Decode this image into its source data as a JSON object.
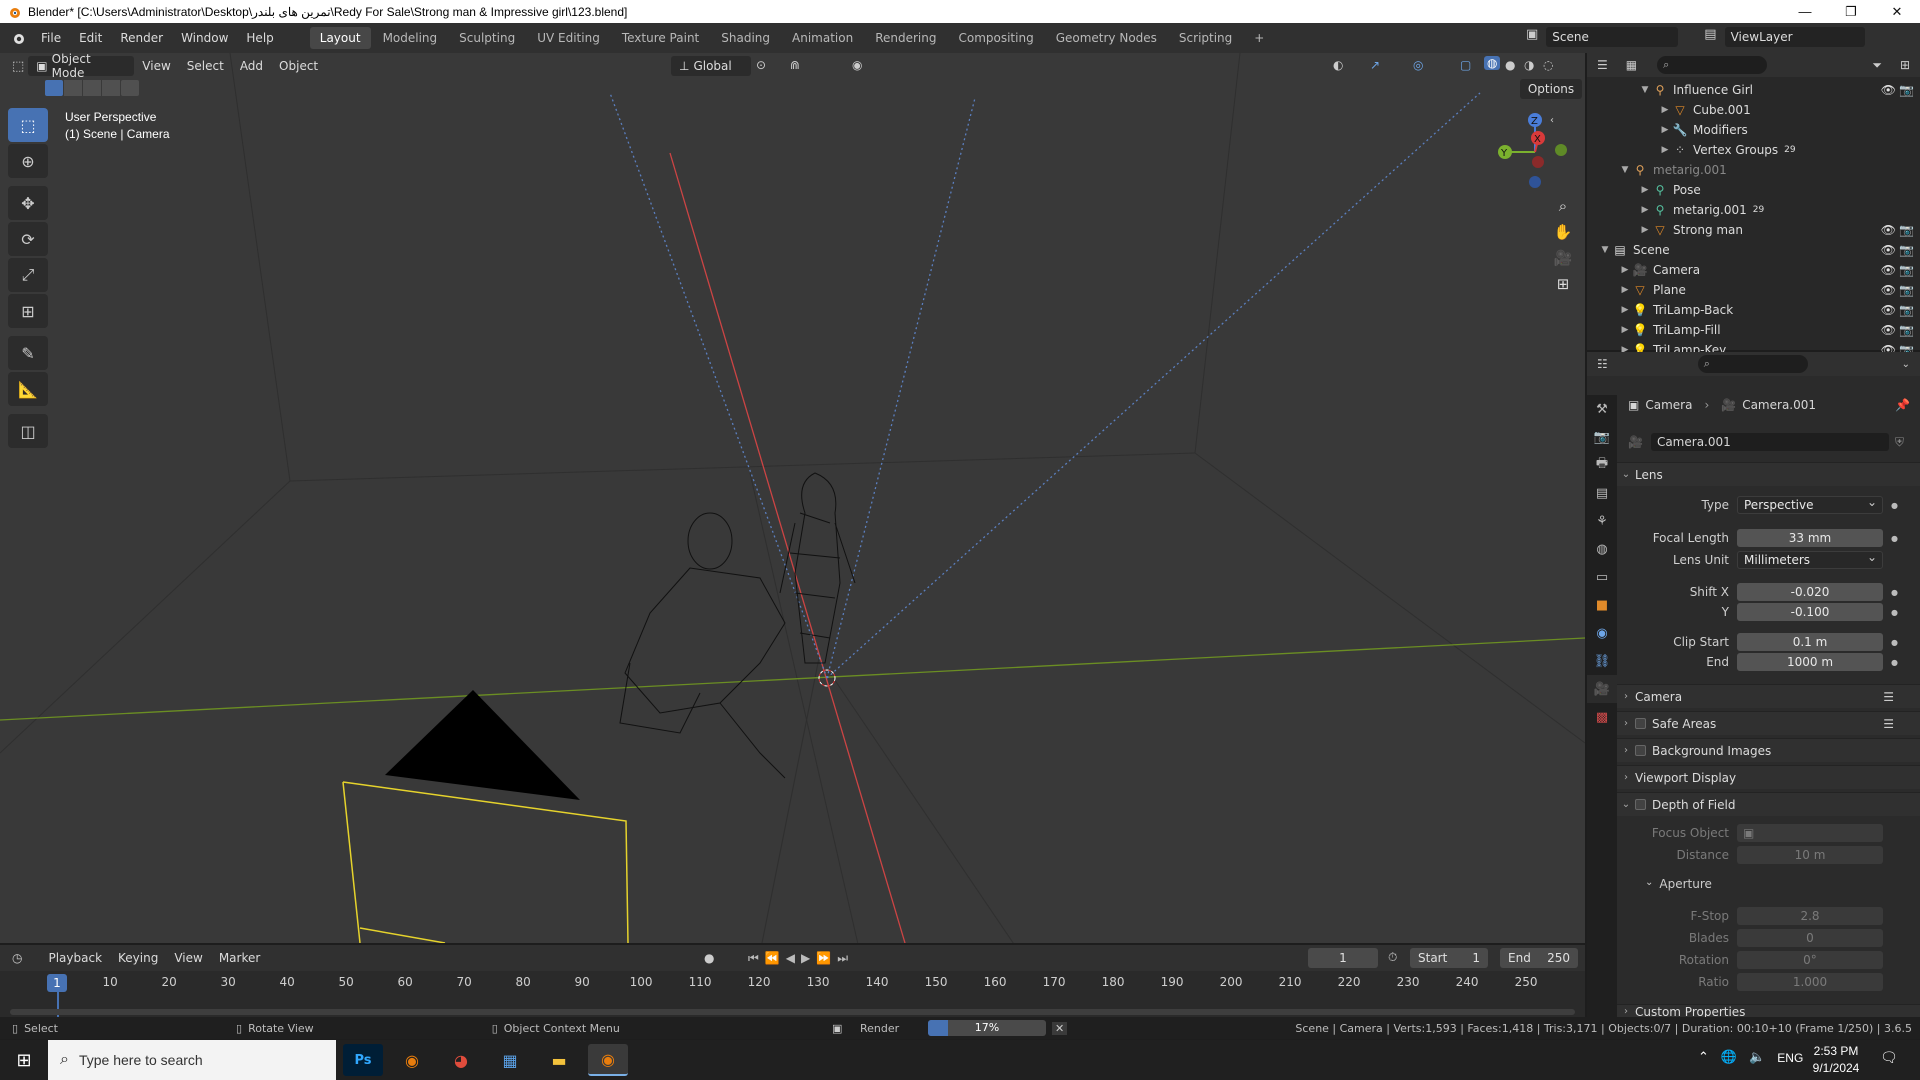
{
  "window": {
    "title": "Blender* [C:\\Users\\Administrator\\Desktop\\تمرین های بلندر\\Redy For Sale\\Strong man & Impressive girl\\123.blend]",
    "controls": [
      "—",
      "❐",
      "✕"
    ]
  },
  "menubar": {
    "menus": [
      "File",
      "Edit",
      "Render",
      "Window",
      "Help"
    ],
    "workspaces": [
      "Layout",
      "Modeling",
      "Sculpting",
      "UV Editing",
      "Texture Paint",
      "Shading",
      "Animation",
      "Rendering",
      "Compositing",
      "Geometry Nodes",
      "Scripting"
    ],
    "active_workspace": "Layout",
    "add_tab": "+",
    "scene_label": "Scene",
    "viewlayer_label": "ViewLayer"
  },
  "viewport": {
    "mode": "Object Mode",
    "menus": [
      "View",
      "Select",
      "Add",
      "Object"
    ],
    "orientation": "Global",
    "options_label": "Options",
    "overlay_line1": "User Perspective",
    "overlay_line2": "(1) Scene | Camera",
    "gizmo_axes": [
      "Z",
      "Y",
      "X"
    ]
  },
  "outliner": {
    "search_placeholder": "",
    "rows": [
      {
        "label": "Influence Girl",
        "icon": "armature-icon",
        "indent": 2
      },
      {
        "label": "Cube.001",
        "icon": "mesh-icon",
        "indent": 3
      },
      {
        "label": "Modifiers",
        "icon": "wrench-icon",
        "indent": 3
      },
      {
        "label": "Vertex Groups",
        "icon": "vertex-group-icon",
        "indent": 3,
        "badge": "29"
      },
      {
        "label": "metarig.001",
        "icon": "armature-icon",
        "indent": 1
      },
      {
        "label": "Pose",
        "icon": "pose-icon",
        "indent": 2
      },
      {
        "label": "metarig.001",
        "icon": "bone-icon",
        "indent": 2,
        "badge": "29"
      },
      {
        "label": "Strong man",
        "icon": "mesh-icon",
        "indent": 2
      },
      {
        "label": "Scene",
        "icon": "collection-icon",
        "indent": 0
      },
      {
        "label": "Camera",
        "icon": "camera-icon",
        "indent": 1
      },
      {
        "label": "Plane",
        "icon": "mesh-icon",
        "indent": 1
      },
      {
        "label": "TriLamp-Back",
        "icon": "light-icon",
        "indent": 1
      },
      {
        "label": "TriLamp-Fill",
        "icon": "light-icon",
        "indent": 1
      },
      {
        "label": "TriLamp-Key",
        "icon": "light-icon",
        "indent": 1
      }
    ]
  },
  "properties": {
    "breadcrumb_object": "Camera",
    "breadcrumb_data": "Camera.001",
    "datablock_name": "Camera.001",
    "lens_panel": "Lens",
    "type_label": "Type",
    "type_value": "Perspective",
    "focal_label": "Focal Length",
    "focal_value": "33 mm",
    "lens_unit_label": "Lens Unit",
    "lens_unit_value": "Millimeters",
    "shift_x_label": "Shift X",
    "shift_x_value": "-0.020",
    "shift_y_label": "Y",
    "shift_y_value": "-0.100",
    "clip_start_label": "Clip Start",
    "clip_start_value": "0.1 m",
    "clip_end_label": "End",
    "clip_end_value": "1000 m",
    "panels": [
      "Camera",
      "Safe Areas",
      "Background Images",
      "Viewport Display",
      "Depth of Field"
    ],
    "focus_object_label": "Focus Object",
    "distance_label": "Distance",
    "distance_value": "10 m",
    "aperture_panel": "Aperture",
    "fstop_label": "F-Stop",
    "fstop_value": "2.8",
    "blades_label": "Blades",
    "blades_value": "0",
    "rotation_label": "Rotation",
    "rotation_value": "0°",
    "ratio_label": "Ratio",
    "ratio_value": "1.000",
    "custom_props_panel": "Custom Properties"
  },
  "timeline": {
    "menus": [
      "Playback",
      "Keying",
      "View",
      "Marker"
    ],
    "current_frame": "1",
    "start_label": "Start",
    "start_value": "1",
    "end_label": "End",
    "end_value": "250",
    "ticks": [
      "10",
      "20",
      "30",
      "40",
      "50",
      "60",
      "70",
      "80",
      "90",
      "100",
      "110",
      "120",
      "130",
      "140",
      "150",
      "160",
      "170",
      "180",
      "190",
      "200",
      "210",
      "220",
      "230",
      "240",
      "250"
    ],
    "playhead_label": "1"
  },
  "statusbar": {
    "select": "Select",
    "rotate": "Rotate View",
    "context": "Object Context Menu",
    "render_label": "Render",
    "render_progress": 0.17,
    "render_progress_text": "17%",
    "stats": "Scene | Camera | Verts:1,593 | Faces:1,418 | Tris:3,171 | Objects:0/7 | Duration: 00:10+10 (Frame 1/250) | 3.6.5"
  },
  "taskbar": {
    "search_placeholder": "Type here to search",
    "lang": "ENG",
    "time": "2:53 PM",
    "date": "9/1/2024"
  }
}
